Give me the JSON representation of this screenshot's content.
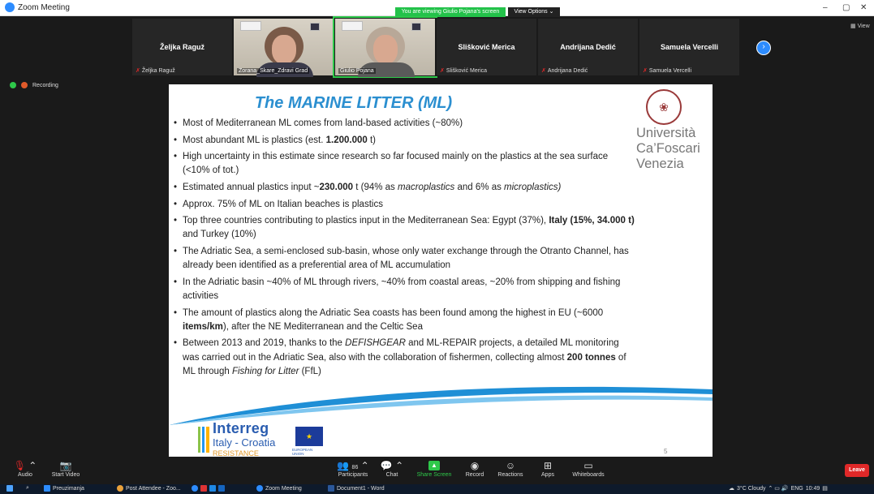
{
  "window": {
    "title": "Zoom Meeting"
  },
  "banner": {
    "viewing": "You are viewing Giulio Pojana's screen",
    "view_options": "View Options ⌄"
  },
  "gallery": {
    "tiles": [
      {
        "kind": "name",
        "name": "Željka Raguž",
        "label": "Željka Raguž",
        "muted": true
      },
      {
        "kind": "video",
        "label": "Zorana_Skare_Zdravi Grad",
        "active": false
      },
      {
        "kind": "video",
        "label": "Giulio Pojana",
        "active": true
      },
      {
        "kind": "name",
        "name": "Slišković Merica",
        "label": "Slišković Merica",
        "muted": true
      },
      {
        "kind": "name",
        "name": "Andrijana Dedić",
        "label": "Andrijana Dedić",
        "muted": true
      },
      {
        "kind": "name",
        "name": "Samuela Vercelli",
        "label": "Samuela Vercelli",
        "muted": true
      }
    ],
    "next_page": "›",
    "view": "View"
  },
  "recording": {
    "label": "Recording"
  },
  "slide": {
    "title": "The MARINE LITTER (ML)",
    "university": [
      "Università",
      "Ca’Foscari",
      "Venezia"
    ],
    "bullets": [
      [
        {
          "t": "Most of Mediterranean ML comes from land-based activities (~80%)"
        }
      ],
      [
        {
          "t": "Most abundant ML is plastics (est. "
        },
        {
          "t": "1.200.000",
          "b": true
        },
        {
          "t": " t)"
        }
      ],
      [
        {
          "t": "High uncertainty in this estimate since research so far focused mainly on the plastics at the sea surface (<10% of tot.)"
        }
      ],
      [
        {
          "t": "Estimated annual plastics input ~"
        },
        {
          "t": "230.000",
          "b": true
        },
        {
          "t": " t (94% as "
        },
        {
          "t": "macroplastics",
          "i": true
        },
        {
          "t": " and 6% as "
        },
        {
          "t": "microplastics)",
          "i": true
        }
      ],
      [
        {
          "t": "Approx. 75% of ML on Italian beaches is plastics"
        }
      ],
      [
        {
          "t": "Top three countries contributing to plastics input in the Mediterranean Sea: Egypt (37%), "
        },
        {
          "t": "Italy (15%, 34.000 t)",
          "b": true
        },
        {
          "t": " and Turkey (10%)"
        }
      ],
      [
        {
          "t": "The Adriatic Sea, a semi-enclosed sub-basin, whose only water exchange through the Otranto Channel, has already been identified as a preferential area of ML accumulation"
        }
      ],
      [
        {
          "t": "In the Adriatic basin ~40% of ML through rivers, ~40% from coastal areas, ~20% from shipping and fishing activities"
        }
      ],
      [
        {
          "t": "The amount of plastics along the Adriatic Sea coasts has been found among the highest in EU (~6000 "
        },
        {
          "t": "items/km",
          "b": true
        },
        {
          "t": "), after the NE Mediterranean and the Celtic Sea"
        }
      ],
      [
        {
          "t": "Between 2013 and 2019, thanks to the "
        },
        {
          "t": "DEFISHGEAR",
          "i": true
        },
        {
          "t": " and ML-REPAIR projects, a detailed ML monitoring was carried out in the Adriatic Sea, also with the collaboration of fishermen, collecting almost "
        },
        {
          "t": "200 tonnes",
          "b": true
        },
        {
          "t": " of ML through "
        },
        {
          "t": "Fishing for Litter",
          "i": true
        },
        {
          "t": " (FfL)"
        }
      ]
    ],
    "logo": {
      "word": "Interreg",
      "line2": "Italy - Croatia",
      "line3": "RESISTANCE",
      "eu": "EUROPEAN UNION"
    },
    "page_number": "5"
  },
  "controls": {
    "audio": "Audio",
    "video": "Start Video",
    "participants": "Participants",
    "participants_count": "86",
    "chat": "Chat",
    "share": "Share Screen",
    "record": "Record",
    "reactions": "Reactions",
    "apps": "Apps",
    "whiteboards": "Whiteboards",
    "leave": "Leave"
  },
  "taskbar": {
    "items": [
      "Preuzimanja",
      "Post Attendee - Zoo...",
      "Zoom Meeting",
      "Document1 - Word"
    ],
    "weather": "3°C Cloudy",
    "lang": "ENG",
    "time": "10:49"
  }
}
